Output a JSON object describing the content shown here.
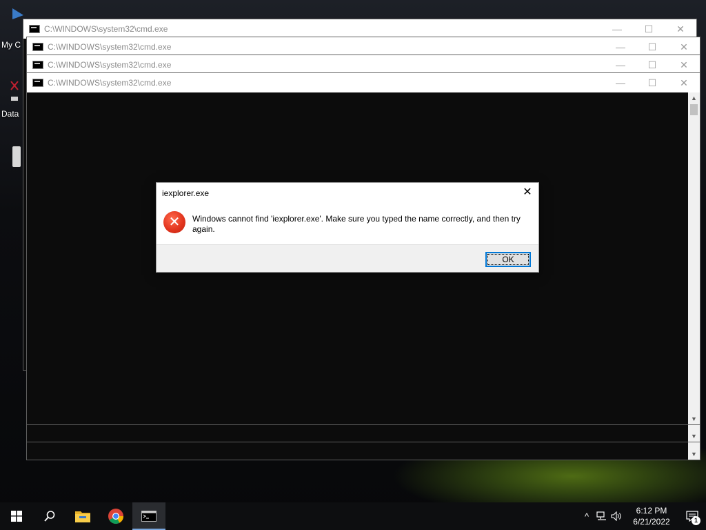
{
  "desktop": {
    "icons": [
      {
        "label": "My C",
        "icon": "computer-icon"
      },
      {
        "label": "Data",
        "icon": "shortcut-icon"
      }
    ]
  },
  "windows": [
    {
      "title": "C:\\WINDOWS\\system32\\cmd.exe"
    },
    {
      "title": "C:\\WINDOWS\\system32\\cmd.exe"
    },
    {
      "title": "C:\\WINDOWS\\system32\\cmd.exe"
    },
    {
      "title": "C:\\WINDOWS\\system32\\cmd.exe"
    }
  ],
  "window_controls": {
    "minimize": "—",
    "maximize": "☐",
    "close": "✕"
  },
  "dialog": {
    "title": "iexplorer.exe",
    "close": "✕",
    "message": "Windows cannot find 'iexplorer.exe'. Make sure you typed the name correctly, and then try again.",
    "ok_label": "OK",
    "icon": "error-icon"
  },
  "taskbar": {
    "pinned": [
      "start-icon",
      "search-icon",
      "file-explorer-icon",
      "chrome-icon",
      "cmd-icon"
    ],
    "tray": {
      "chevron": "^",
      "time": "6:12 PM",
      "date": "6/21/2022",
      "notification_count": "1"
    }
  },
  "colors": {
    "accent": "#0078d7",
    "error": "#e3361f",
    "console_bg": "#0c0c0c",
    "taskbar_bg": "#0d0e10"
  }
}
